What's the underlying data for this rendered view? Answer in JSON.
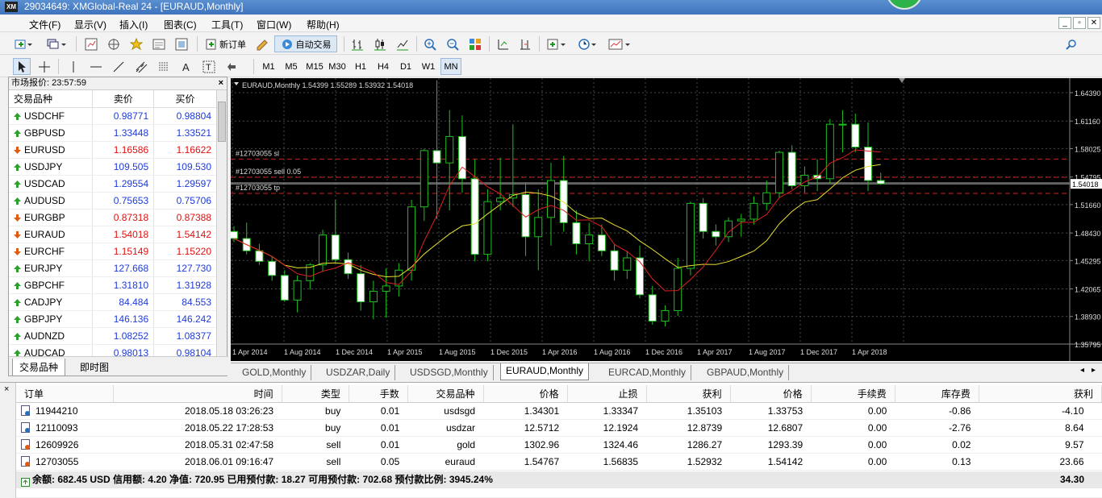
{
  "window": {
    "title": "29034649: XMGlobal-Real 24 - [EURAUD,Monthly]",
    "logo": "XM"
  },
  "menu": [
    "文件(F)",
    "显示(V)",
    "插入(I)",
    "图表(C)",
    "工具(T)",
    "窗口(W)",
    "帮助(H)"
  ],
  "toolbar": {
    "new_order": "新订单",
    "auto_trading": "自动交易"
  },
  "timeframes": [
    "M1",
    "M5",
    "M15",
    "M30",
    "H1",
    "H4",
    "D1",
    "W1",
    "MN"
  ],
  "market_watch": {
    "title": "市场报价: 23:57:59",
    "columns": [
      "交易品种",
      "卖价",
      "买价"
    ],
    "rows": [
      {
        "symbol": "USDCHF",
        "bid": "0.98771",
        "ask": "0.98804",
        "dir": "up"
      },
      {
        "symbol": "GBPUSD",
        "bid": "1.33448",
        "ask": "1.33521",
        "dir": "up"
      },
      {
        "symbol": "EURUSD",
        "bid": "1.16586",
        "ask": "1.16622",
        "dir": "down"
      },
      {
        "symbol": "USDJPY",
        "bid": "109.505",
        "ask": "109.530",
        "dir": "up"
      },
      {
        "symbol": "USDCAD",
        "bid": "1.29554",
        "ask": "1.29597",
        "dir": "up"
      },
      {
        "symbol": "AUDUSD",
        "bid": "0.75653",
        "ask": "0.75706",
        "dir": "up"
      },
      {
        "symbol": "EURGBP",
        "bid": "0.87318",
        "ask": "0.87388",
        "dir": "down"
      },
      {
        "symbol": "EURAUD",
        "bid": "1.54018",
        "ask": "1.54142",
        "dir": "down"
      },
      {
        "symbol": "EURCHF",
        "bid": "1.15149",
        "ask": "1.15220",
        "dir": "down"
      },
      {
        "symbol": "EURJPY",
        "bid": "127.668",
        "ask": "127.730",
        "dir": "up"
      },
      {
        "symbol": "GBPCHF",
        "bid": "1.31810",
        "ask": "1.31928",
        "dir": "up"
      },
      {
        "symbol": "CADJPY",
        "bid": "84.484",
        "ask": "84.553",
        "dir": "up"
      },
      {
        "symbol": "GBPJPY",
        "bid": "146.136",
        "ask": "146.242",
        "dir": "up"
      },
      {
        "symbol": "AUDNZD",
        "bid": "1.08252",
        "ask": "1.08377",
        "dir": "up"
      },
      {
        "symbol": "AUDCAD",
        "bid": "0.98013",
        "ask": "0.98104",
        "dir": "up"
      }
    ],
    "tabs": [
      "交易品种",
      "即时图"
    ]
  },
  "chart": {
    "header": "EURAUD,Monthly  1.54399 1.55289 1.53932 1.54018",
    "current_price": "1.54018",
    "order_labels": [
      "#12703055 sl",
      "#12703055 sell 0.05",
      "#12703055 tp"
    ]
  },
  "chart_data": {
    "type": "candlestick",
    "ylim": [
      1.3579,
      1.6439
    ],
    "yticks": [
      "1.64390",
      "1.61160",
      "1.58025",
      "1.54795",
      "1.51660",
      "1.48430",
      "1.45295",
      "1.42065",
      "1.38930",
      "1.35795"
    ],
    "xticks": [
      "1 Apr 2014",
      "1 Aug 2014",
      "1 Dec 2014",
      "1 Apr 2015",
      "1 Aug 2015",
      "1 Dec 2015",
      "1 Apr 2016",
      "1 Aug 2016",
      "1 Dec 2016",
      "1 Apr 2017",
      "1 Aug 2017",
      "1 Dec 2017",
      "1 Apr 2018"
    ],
    "levels": {
      "sl": 1.56835,
      "entry": 1.54767,
      "tp": 1.52932,
      "bid": 1.54018,
      "ask": 1.54142
    },
    "candles": [
      [
        1.486,
        1.492,
        1.474,
        1.478
      ],
      [
        1.478,
        1.496,
        1.46,
        1.464
      ],
      [
        1.464,
        1.472,
        1.448,
        1.452
      ],
      [
        1.452,
        1.458,
        1.43,
        1.436
      ],
      [
        1.436,
        1.442,
        1.406,
        1.408
      ],
      [
        1.408,
        1.436,
        1.394,
        1.43
      ],
      [
        1.43,
        1.45,
        1.42,
        1.448
      ],
      [
        1.448,
        1.488,
        1.44,
        1.482
      ],
      [
        1.482,
        1.522,
        1.45,
        1.454
      ],
      [
        1.454,
        1.462,
        1.432,
        1.438
      ],
      [
        1.438,
        1.448,
        1.396,
        1.406
      ],
      [
        1.406,
        1.43,
        1.386,
        1.418
      ],
      [
        1.418,
        1.444,
        1.388,
        1.424
      ],
      [
        1.424,
        1.45,
        1.412,
        1.442
      ],
      [
        1.442,
        1.522,
        1.43,
        1.514
      ],
      [
        1.514,
        1.58,
        1.498,
        1.578
      ],
      [
        1.578,
        1.658,
        1.5,
        1.564
      ],
      [
        1.564,
        1.624,
        1.51,
        1.594
      ],
      [
        1.594,
        1.618,
        1.53,
        1.546
      ],
      [
        1.546,
        1.568,
        1.452,
        1.46
      ],
      [
        1.46,
        1.534,
        1.452,
        1.52
      ],
      [
        1.52,
        1.57,
        1.51,
        1.524
      ],
      [
        1.524,
        1.608,
        1.514,
        1.528
      ],
      [
        1.528,
        1.542,
        1.458,
        1.48
      ],
      [
        1.48,
        1.534,
        1.442,
        1.502
      ],
      [
        1.502,
        1.564,
        1.47,
        1.544
      ],
      [
        1.544,
        1.572,
        1.486,
        1.496
      ],
      [
        1.496,
        1.51,
        1.46,
        1.472
      ],
      [
        1.472,
        1.496,
        1.452,
        1.482
      ],
      [
        1.482,
        1.494,
        1.458,
        1.464
      ],
      [
        1.464,
        1.472,
        1.43,
        1.442
      ],
      [
        1.442,
        1.464,
        1.432,
        1.456
      ],
      [
        1.456,
        1.47,
        1.41,
        1.414
      ],
      [
        1.414,
        1.424,
        1.38,
        1.384
      ],
      [
        1.384,
        1.402,
        1.378,
        1.396
      ],
      [
        1.396,
        1.456,
        1.39,
        1.444
      ],
      [
        1.444,
        1.52,
        1.436,
        1.518
      ],
      [
        1.518,
        1.524,
        1.478,
        1.486
      ],
      [
        1.486,
        1.494,
        1.47,
        1.48
      ],
      [
        1.48,
        1.502,
        1.474,
        1.498
      ],
      [
        1.498,
        1.506,
        1.48,
        1.5
      ],
      [
        1.5,
        1.526,
        1.494,
        1.518
      ],
      [
        1.518,
        1.544,
        1.51,
        1.53
      ],
      [
        1.53,
        1.578,
        1.524,
        1.576
      ],
      [
        1.576,
        1.584,
        1.534,
        1.538
      ],
      [
        1.538,
        1.56,
        1.53,
        1.55
      ],
      [
        1.55,
        1.568,
        1.532,
        1.546
      ],
      [
        1.546,
        1.614,
        1.54,
        1.608
      ],
      [
        1.608,
        1.624,
        1.576,
        1.608
      ],
      [
        1.608,
        1.62,
        1.576,
        1.582
      ],
      [
        1.582,
        1.61,
        1.532,
        1.544
      ],
      [
        1.544,
        1.553,
        1.539,
        1.5402
      ]
    ]
  },
  "chart_tabs": [
    "GOLD,Monthly",
    "USDZAR,Daily",
    "USDSGD,Monthly",
    "EURAUD,Monthly",
    "EURCAD,Monthly",
    "GBPAUD,Monthly"
  ],
  "orders": {
    "columns": [
      "订单",
      "时间",
      "类型",
      "手数",
      "交易品种",
      "价格",
      "止损",
      "获利",
      "价格",
      "手续费",
      "库存费",
      "获利"
    ],
    "rows": [
      [
        "11944210",
        "2018.05.18 03:26:23",
        "buy",
        "0.01",
        "usdsgd",
        "1.34301",
        "1.33347",
        "1.35103",
        "1.33753",
        "0.00",
        "-0.86",
        "-4.10"
      ],
      [
        "12110093",
        "2018.05.22 17:28:53",
        "buy",
        "0.01",
        "usdzar",
        "12.5712",
        "12.1924",
        "12.8739",
        "12.6807",
        "0.00",
        "-2.76",
        "8.64"
      ],
      [
        "12609926",
        "2018.05.31 02:47:58",
        "sell",
        "0.01",
        "gold",
        "1302.96",
        "1324.46",
        "1286.27",
        "1293.39",
        "0.00",
        "0.02",
        "9.57"
      ],
      [
        "12703055",
        "2018.06.01 09:16:47",
        "sell",
        "0.05",
        "euraud",
        "1.54767",
        "1.56835",
        "1.52932",
        "1.54142",
        "0.00",
        "0.13",
        "23.66"
      ]
    ],
    "balance_line": "余额: 682.45 USD  信用额: 4.20  净值: 720.95  已用预付款: 18.27  可用预付款: 702.68  预付款比例: 3945.24%",
    "total": "34.30"
  }
}
